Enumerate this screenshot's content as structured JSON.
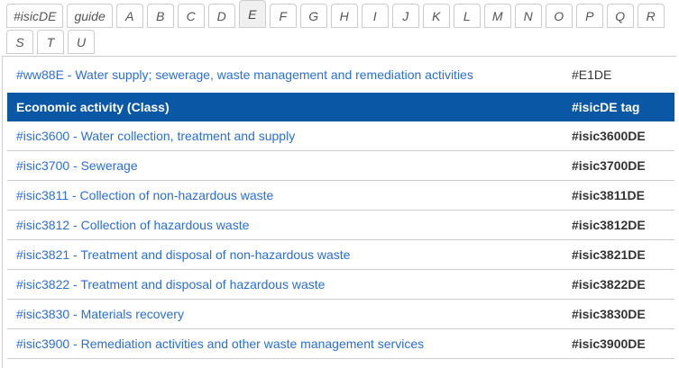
{
  "tabs": {
    "row1": [
      "#isicDE",
      "guide",
      "A",
      "B",
      "C",
      "D",
      "E",
      "F",
      "G",
      "H",
      "I",
      "J",
      "K",
      "L",
      "M",
      "N",
      "O",
      "P",
      "Q",
      "R"
    ],
    "row2": [
      "S",
      "T",
      "U"
    ],
    "active_tab": "E"
  },
  "intro": {
    "link_label": "#ww88E - Water supply; sewerage, waste management and remediation activities",
    "tag": "#E1DE"
  },
  "table": {
    "headers": [
      "Economic activity (Class)",
      "#isicDE tag"
    ],
    "rows": [
      {
        "link": "#isic3600 - Water collection, treatment and supply",
        "tag": "#isic3600DE"
      },
      {
        "link": "#isic3700 - Sewerage",
        "tag": "#isic3700DE"
      },
      {
        "link": "#isic3811 - Collection of non-hazardous waste",
        "tag": "#isic3811DE"
      },
      {
        "link": "#isic3812 - Collection of hazardous waste",
        "tag": "#isic3812DE"
      },
      {
        "link": "#isic3821 - Treatment and disposal of non-hazardous waste",
        "tag": "#isic3821DE"
      },
      {
        "link": "#isic3822 - Treatment and disposal of hazardous waste",
        "tag": "#isic3822DE"
      },
      {
        "link": "#isic3830 - Materials recovery",
        "tag": "#isic3830DE"
      },
      {
        "link": "#isic3900 - Remediation activities and other waste management services",
        "tag": "#isic3900DE"
      }
    ]
  },
  "colors": {
    "header_bg": "#0a57a6",
    "link_color": "#2a6fd6",
    "active_tab_bg": "#f0f0f0"
  }
}
